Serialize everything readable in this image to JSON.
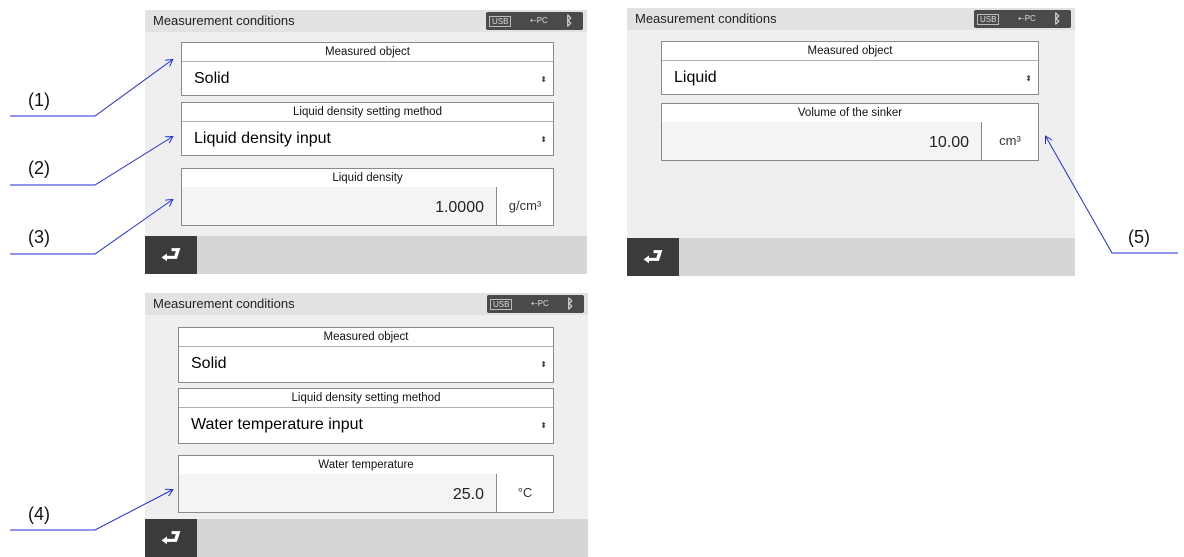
{
  "screens": {
    "s1": {
      "title": "Measurement conditions",
      "status": {
        "usb": "USB",
        "pc": "PC",
        "bt": "bluetooth-icon"
      },
      "f1_header": "Measured object",
      "f1_value": "Solid",
      "f2_header": "Liquid density setting method",
      "f2_value": "Liquid density input",
      "f3_header": "Liquid density",
      "f3_value": "1.0000",
      "f3_unit": "g/cm³"
    },
    "s2": {
      "title": "Measurement conditions",
      "status": {
        "usb": "USB",
        "pc": "PC",
        "bt": "bluetooth-icon"
      },
      "f1_header": "Measured object",
      "f1_value": "Liquid",
      "f2_header": "Volume of the sinker",
      "f2_value": "10.00",
      "f2_unit": "cm³"
    },
    "s3": {
      "title": "Measurement conditions",
      "status": {
        "usb": "USB",
        "pc": "PC",
        "bt": "bluetooth-icon"
      },
      "f1_header": "Measured object",
      "f1_value": "Solid",
      "f2_header": "Liquid density setting method",
      "f2_value": "Water temperature input",
      "f3_header": "Water temperature",
      "f3_value": "25.0",
      "f3_unit": "°C"
    }
  },
  "annotations": [
    "(1)",
    "(2)",
    "(3)",
    "(4)",
    "(5)"
  ],
  "icons": {
    "dropdown": "updown-arrow-icon",
    "back": "back-arrow-icon",
    "bluetooth": "bluetooth-icon"
  },
  "colors": {
    "leader_line": "#1f2fd8",
    "screen_bg": "#efefef",
    "back_button": "#3b3b3b"
  }
}
